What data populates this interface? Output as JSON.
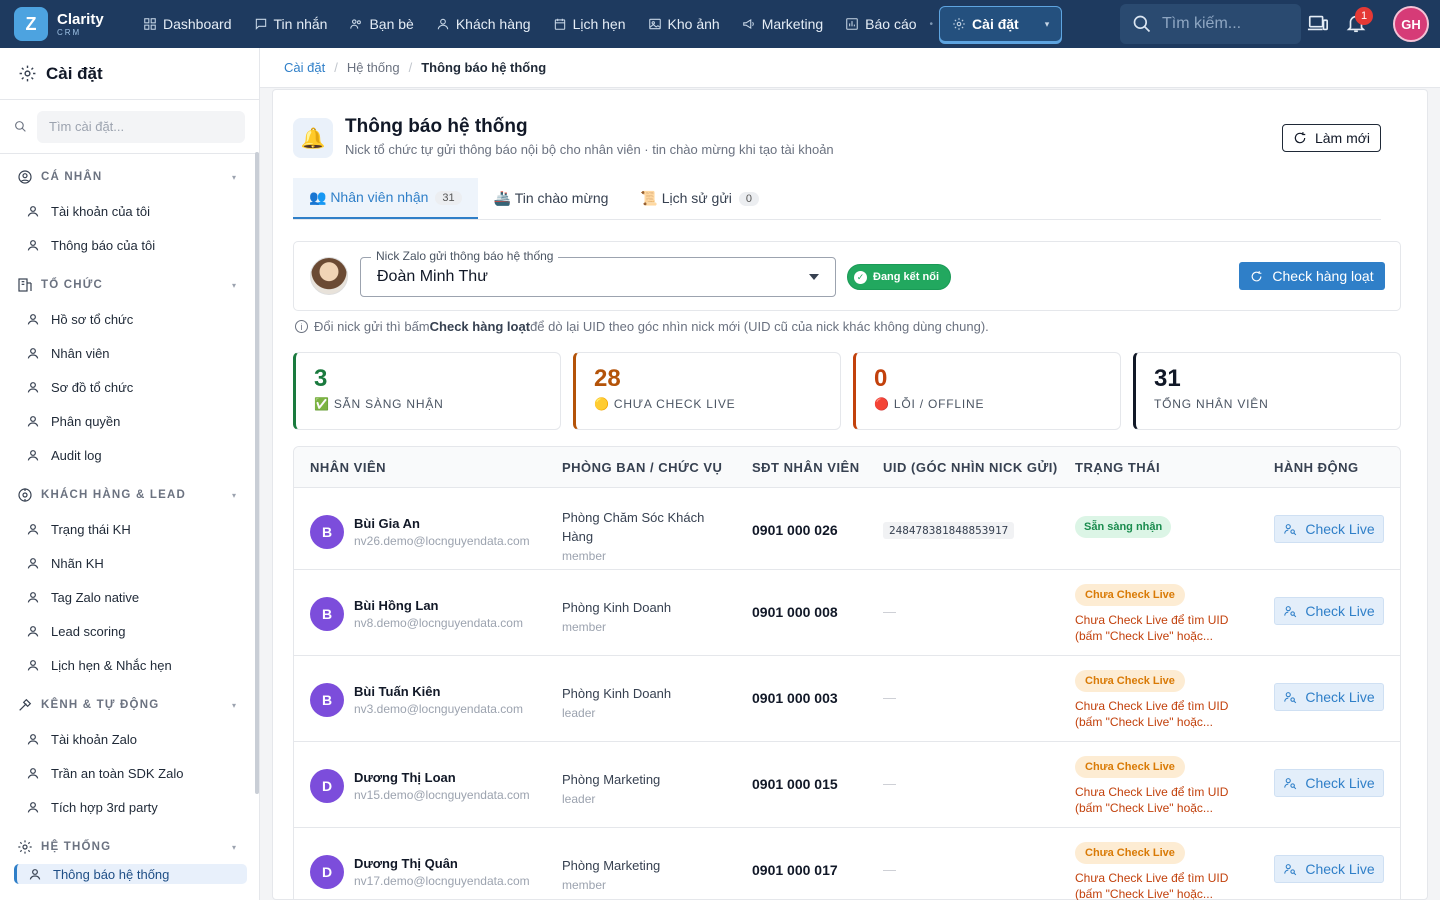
{
  "app": {
    "name": "Clarity",
    "sub": "CRM",
    "logo_letter": "Z"
  },
  "nav": [
    {
      "label": "Dashboard",
      "icon": "grid-icon"
    },
    {
      "label": "Tin nhắn",
      "icon": "chat-icon"
    },
    {
      "label": "Bạn bè",
      "icon": "friends-icon"
    },
    {
      "label": "Khách hàng",
      "icon": "person-icon"
    },
    {
      "label": "Lịch hẹn",
      "icon": "calendar-icon"
    },
    {
      "label": "Kho ảnh",
      "icon": "image-icon"
    },
    {
      "label": "Marketing",
      "icon": "megaphone-icon"
    },
    {
      "label": "Báo cáo",
      "icon": "chart-icon"
    }
  ],
  "nav_active": "Cài đặt",
  "search_placeholder": "Tìm kiếm...",
  "notif_count": "1",
  "user_initials": "GH",
  "sidebar": {
    "title": "Cài đặt",
    "search_placeholder": "Tìm cài đặt...",
    "sections": [
      {
        "title": "CÁ NHÂN",
        "items": [
          "Tài khoản của tôi",
          "Thông báo của tôi"
        ]
      },
      {
        "title": "TỔ CHỨC",
        "items": [
          "Hồ sơ tổ chức",
          "Nhân viên",
          "Sơ đồ tổ chức",
          "Phân quyền",
          "Audit log"
        ]
      },
      {
        "title": "KHÁCH HÀNG & LEAD",
        "items": [
          "Trạng thái KH",
          "Nhãn KH",
          "Tag Zalo native",
          "Lead scoring",
          "Lịch hẹn & Nhắc hẹn"
        ]
      },
      {
        "title": "KÊNH & TỰ ĐỘNG",
        "items": [
          "Tài khoản Zalo",
          "Trần an toàn SDK Zalo",
          "Tích hợp 3rd party"
        ]
      },
      {
        "title": "HỆ THỐNG",
        "items": [
          "Thông báo hệ thống"
        ]
      }
    ]
  },
  "breadcrumb": {
    "root": "Cài đặt",
    "mid": "Hệ thống",
    "current": "Thông báo hệ thống"
  },
  "page": {
    "title": "Thông báo hệ thống",
    "subtitle": "Nick tổ chức tự gửi thông báo nội bộ cho nhân viên · tin chào mừng khi tạo tài khoản",
    "refresh_label": "Làm mới"
  },
  "tabs": [
    {
      "label": "👥 Nhân viên nhận",
      "count": "31"
    },
    {
      "label": "🚢 Tin chào mừng",
      "count": ""
    },
    {
      "label": "📜 Lịch sử gửi",
      "count": "0"
    }
  ],
  "sender": {
    "label": "Nick Zalo gửi thông báo hệ thống",
    "value": "Đoàn Minh Thư",
    "status": "Đang kết nối",
    "bulk_label": "Check hàng loạt"
  },
  "hint": {
    "pre": "Đổi nick gửi thì bấm",
    "bold": "Check hàng loạt",
    "post": "để dò lại UID theo góc nhìn nick mới (UID cũ của nick khác không dùng chung)."
  },
  "stats": [
    {
      "value": "3",
      "label": "✅ SẴN SÀNG NHẬN",
      "color": "#1a7a3e"
    },
    {
      "value": "28",
      "label": "🟡 CHƯA CHECK LIVE",
      "color": "#b45309"
    },
    {
      "value": "0",
      "label": "🔴 LỖI / OFFLINE",
      "color": "#c2410c"
    },
    {
      "value": "31",
      "label": "TỔNG NHÂN VIÊN",
      "color": "#111827"
    }
  ],
  "table": {
    "headers": [
      "NHÂN VIÊN",
      "PHÒNG BAN / CHỨC VỤ",
      "SĐT NHÂN VIÊN",
      "UID (GÓC NHÌN NICK GỬI)",
      "TRẠNG THÁI",
      "HÀNH ĐỘNG"
    ],
    "action_label": "Check Live",
    "status_ok": "Sẵn sàng nhận",
    "status_warn": "Chưa Check Live",
    "warn_text": "Chưa Check Live để tìm UID (bấm \"Check Live\" hoặc...",
    "uid_empty": "—",
    "rows": [
      {
        "initial": "B",
        "name": "Bùi Gia An",
        "email": "nv26.demo@locnguyendata.com",
        "dept": "Phòng Chăm Sóc Khách Hàng",
        "role": "member",
        "phone": "0901 000 026",
        "uid": "248478381848853917",
        "status": "ok"
      },
      {
        "initial": "B",
        "name": "Bùi Hồng Lan",
        "email": "nv8.demo@locnguyendata.com",
        "dept": "Phòng Kinh Doanh",
        "role": "member",
        "phone": "0901 000 008",
        "uid": "",
        "status": "warn"
      },
      {
        "initial": "B",
        "name": "Bùi Tuấn Kiên",
        "email": "nv3.demo@locnguyendata.com",
        "dept": "Phòng Kinh Doanh",
        "role": "leader",
        "phone": "0901 000 003",
        "uid": "",
        "status": "warn"
      },
      {
        "initial": "D",
        "name": "Dương Thị Loan",
        "email": "nv15.demo@locnguyendata.com",
        "dept": "Phòng Marketing",
        "role": "leader",
        "phone": "0901 000 015",
        "uid": "",
        "status": "warn"
      },
      {
        "initial": "D",
        "name": "Dương Thị Quân",
        "email": "nv17.demo@locnguyendata.com",
        "dept": "Phòng Marketing",
        "role": "member",
        "phone": "0901 000 017",
        "uid": "",
        "status": "warn"
      }
    ]
  }
}
